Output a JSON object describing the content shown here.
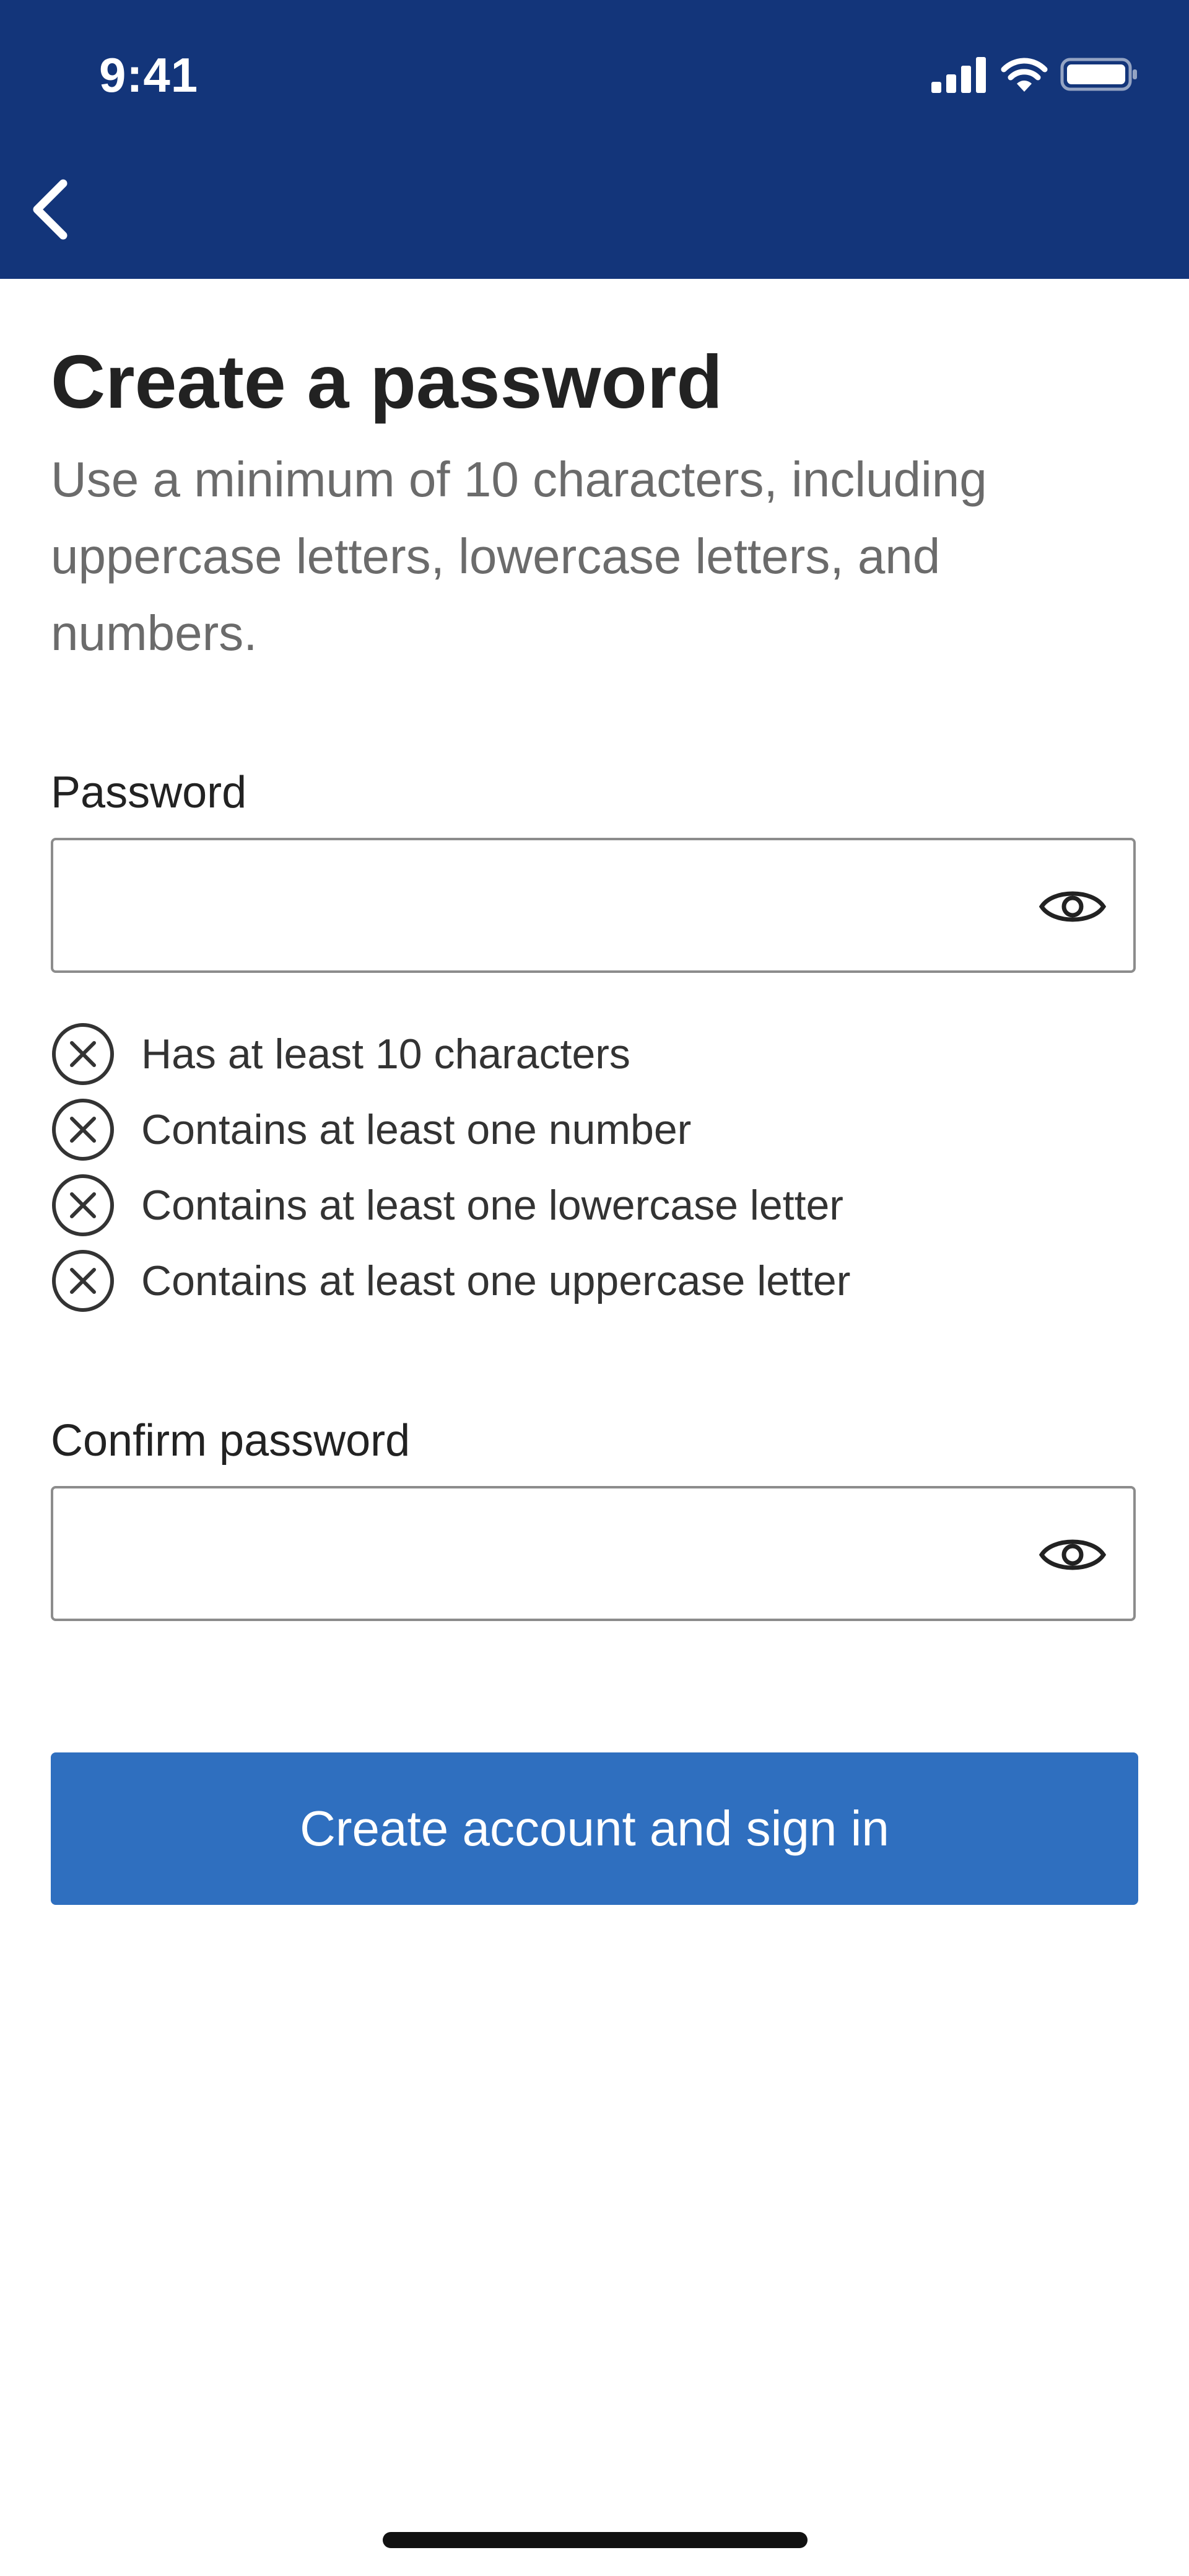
{
  "status_bar": {
    "time": "9:41",
    "icons": [
      "signal-icon",
      "wifi-icon",
      "battery-icon"
    ]
  },
  "nav": {
    "back_icon": "chevron-left-icon"
  },
  "page": {
    "title": "Create a password",
    "subtitle": "Use a minimum of 10 characters, including uppercase letters, lowercase letters, and numbers."
  },
  "password": {
    "label": "Password",
    "value": "",
    "toggle_icon": "eye-icon"
  },
  "requirements": [
    {
      "text": "Has at least 10 characters",
      "met": false
    },
    {
      "text": "Contains at least one number",
      "met": false
    },
    {
      "text": "Contains at least one lowercase letter",
      "met": false
    },
    {
      "text": "Contains at least one uppercase letter",
      "met": false
    }
  ],
  "confirm_password": {
    "label": "Confirm password",
    "value": "",
    "toggle_icon": "eye-icon"
  },
  "submit": {
    "label": "Create account and sign in"
  },
  "colors": {
    "header_bg": "#13357a",
    "primary_button": "#2f6fbf",
    "title_text": "#222222",
    "subtitle_text": "#6b6b6b",
    "field_border": "#8c8c8c"
  }
}
